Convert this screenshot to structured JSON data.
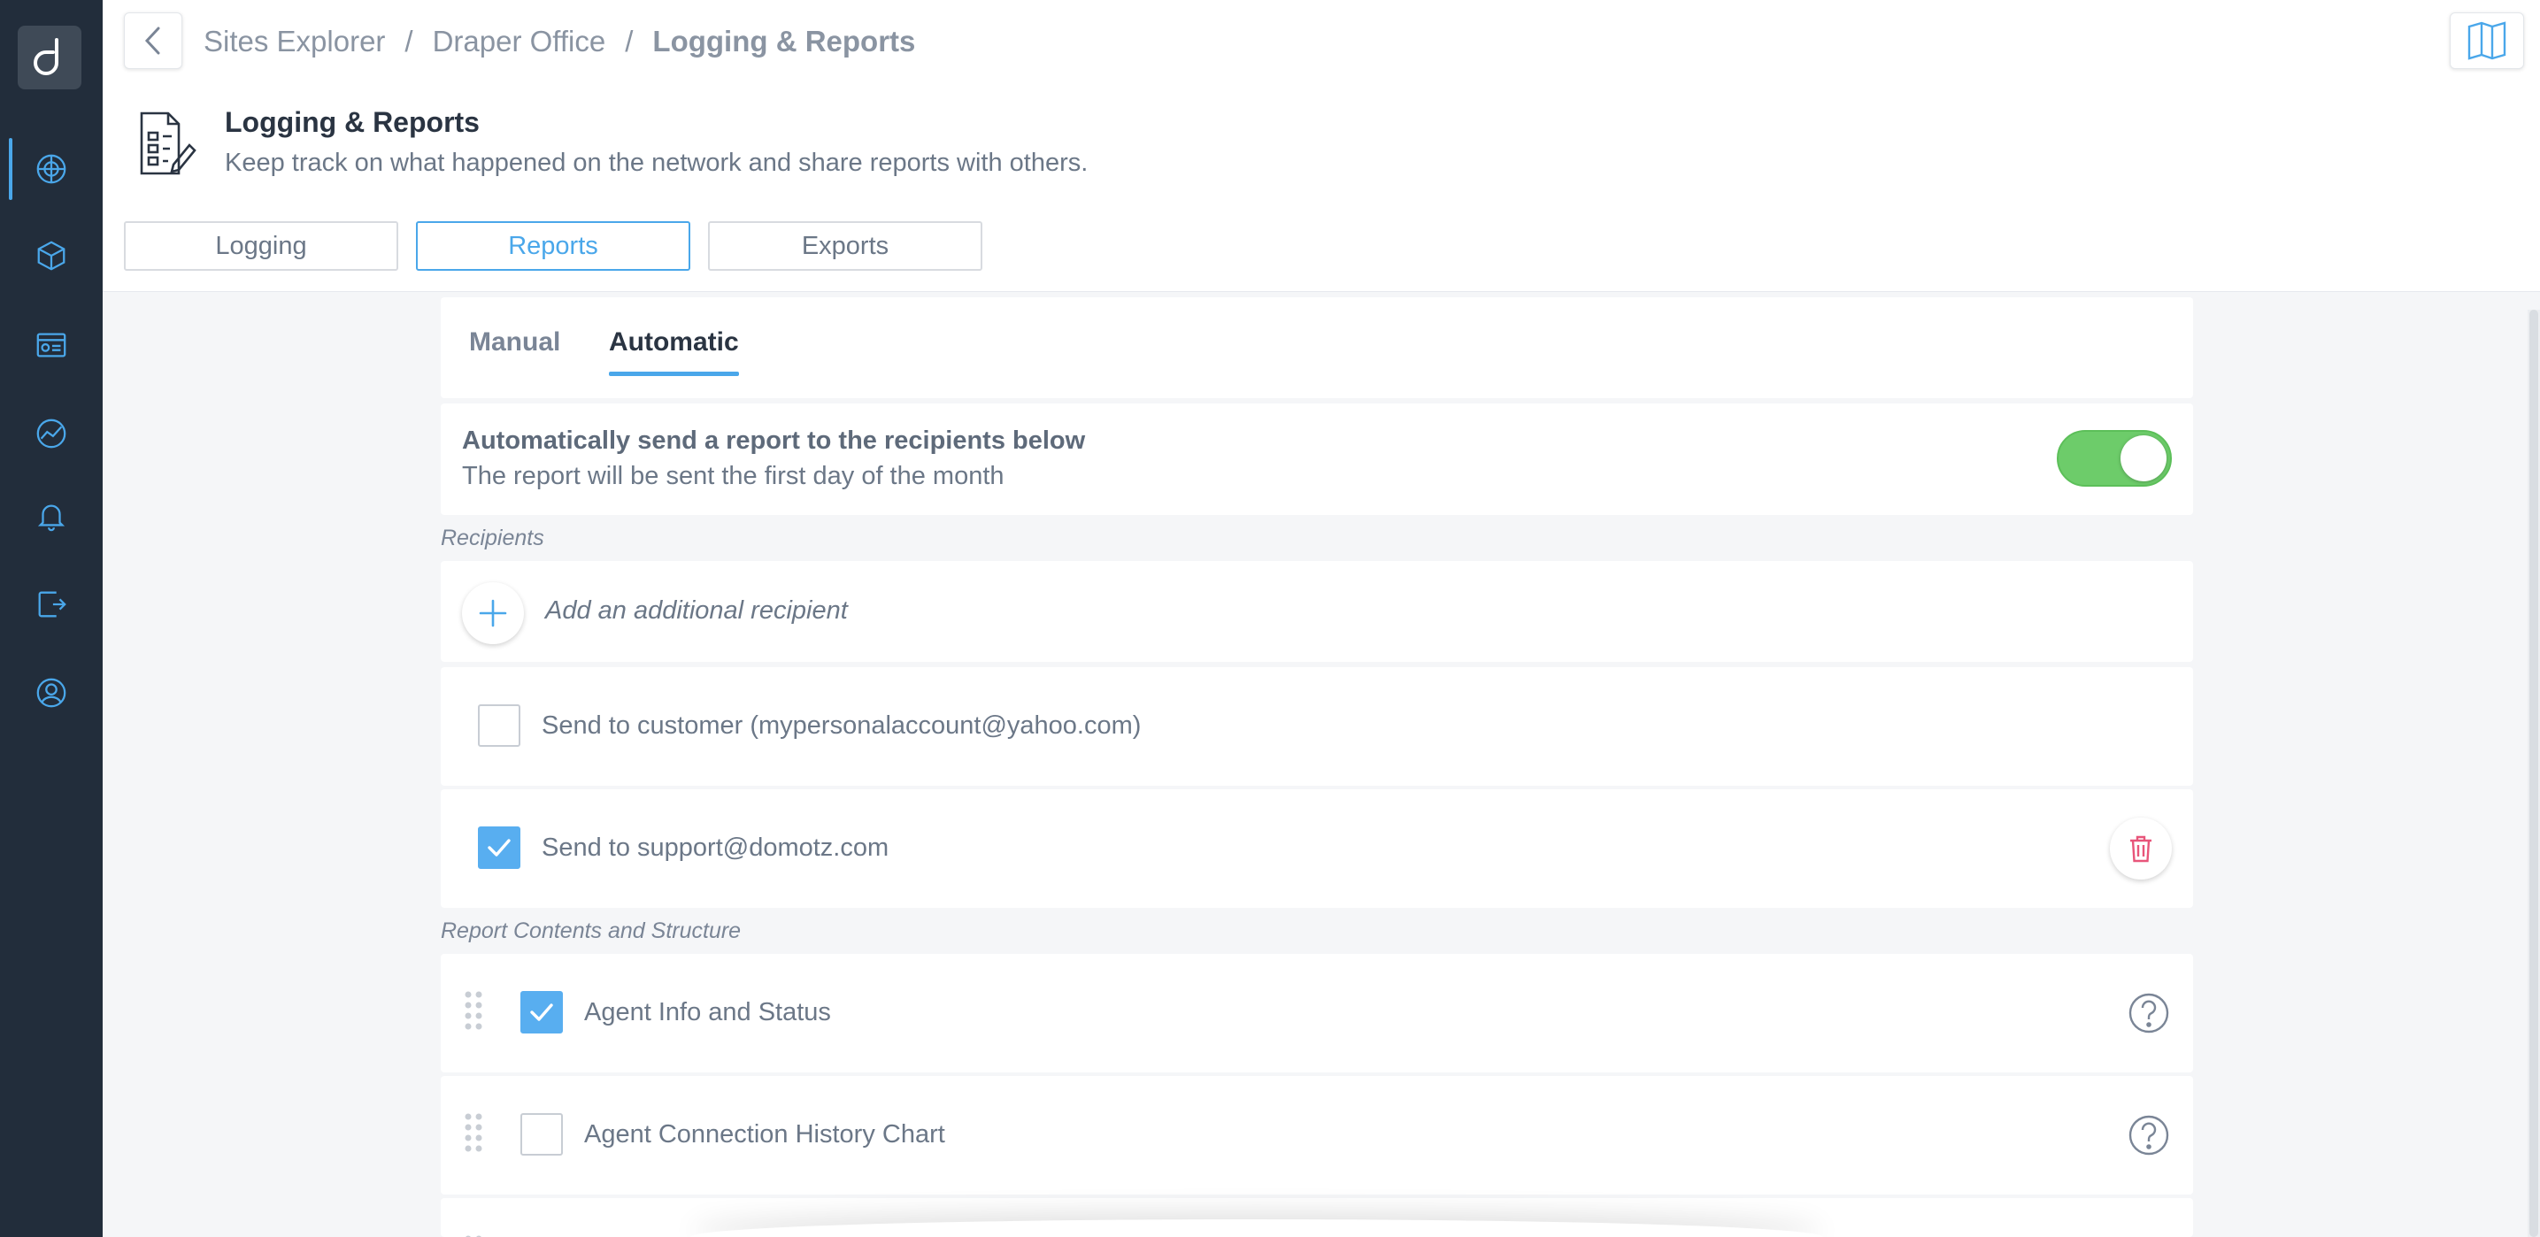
{
  "breadcrumb": {
    "items": [
      "Sites Explorer",
      "Draper Office",
      "Logging & Reports"
    ],
    "separator": "/"
  },
  "page": {
    "title": "Logging & Reports",
    "subtitle": "Keep track on what happened on the network and share reports with others."
  },
  "segments": [
    {
      "label": "Logging",
      "active": false
    },
    {
      "label": "Reports",
      "active": true
    },
    {
      "label": "Exports",
      "active": false
    }
  ],
  "tabs": [
    {
      "label": "Manual",
      "active": false
    },
    {
      "label": "Automatic",
      "active": true
    }
  ],
  "auto_send": {
    "title": "Automatically send a report to the recipients below",
    "description": "The report will be sent the first day of the month",
    "enabled": true
  },
  "recipients": {
    "section_label": "Recipients",
    "add_label": "Add an additional recipient",
    "items": [
      {
        "label": "Send to customer (mypersonalaccount@yahoo.com)",
        "checked": false,
        "deletable": false
      },
      {
        "label": "Send to support@domotz.com",
        "checked": true,
        "deletable": true
      }
    ]
  },
  "report_contents": {
    "section_label": "Report Contents and Structure",
    "items": [
      {
        "label": "Agent Info and Status",
        "checked": true
      },
      {
        "label": "Agent Connection History Chart",
        "checked": false
      }
    ]
  },
  "colors": {
    "sidebar": "#222d3b",
    "accent": "#4aa7ea",
    "toggle_on": "#6dcc6a",
    "trash": "#e8557a"
  },
  "icons": {
    "logo": "domotz-logo-icon",
    "nav": [
      "network-globe-icon",
      "cube-icon",
      "dashboard-card-icon",
      "monitoring-icon",
      "bell-icon",
      "share-icon",
      "account-icon"
    ],
    "back": "chevron-left-icon",
    "book": "book-icon",
    "page": "report-document-icon"
  }
}
